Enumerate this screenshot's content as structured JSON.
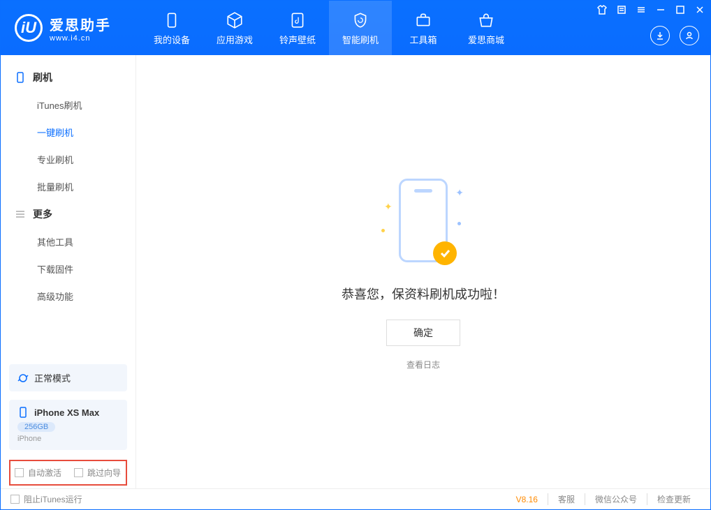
{
  "logo": {
    "title": "爱思助手",
    "subtitle": "www.i4.cn",
    "mark": "iU"
  },
  "nav": {
    "tabs": [
      {
        "label": "我的设备",
        "icon": "device"
      },
      {
        "label": "应用游戏",
        "icon": "cube"
      },
      {
        "label": "铃声壁纸",
        "icon": "music"
      },
      {
        "label": "智能刷机",
        "icon": "shield",
        "active": true
      },
      {
        "label": "工具箱",
        "icon": "toolbox"
      },
      {
        "label": "爱思商城",
        "icon": "shop"
      }
    ]
  },
  "sidebar": {
    "group1": {
      "title": "刷机",
      "items": [
        "iTunes刷机",
        "一键刷机",
        "专业刷机",
        "批量刷机"
      ],
      "active_index": 1
    },
    "group2": {
      "title": "更多",
      "items": [
        "其他工具",
        "下载固件",
        "高级功能"
      ]
    }
  },
  "device": {
    "mode_label": "正常模式",
    "name": "iPhone XS Max",
    "capacity": "256GB",
    "type": "iPhone"
  },
  "bottom_options": {
    "auto_activate": "自动激活",
    "skip_guide": "跳过向导"
  },
  "main": {
    "success_text": "恭喜您，保资料刷机成功啦！",
    "ok_button": "确定",
    "log_link": "查看日志"
  },
  "footer": {
    "block_itunes": "阻止iTunes运行",
    "version": "V8.16",
    "links": [
      "客服",
      "微信公众号",
      "检查更新"
    ]
  }
}
